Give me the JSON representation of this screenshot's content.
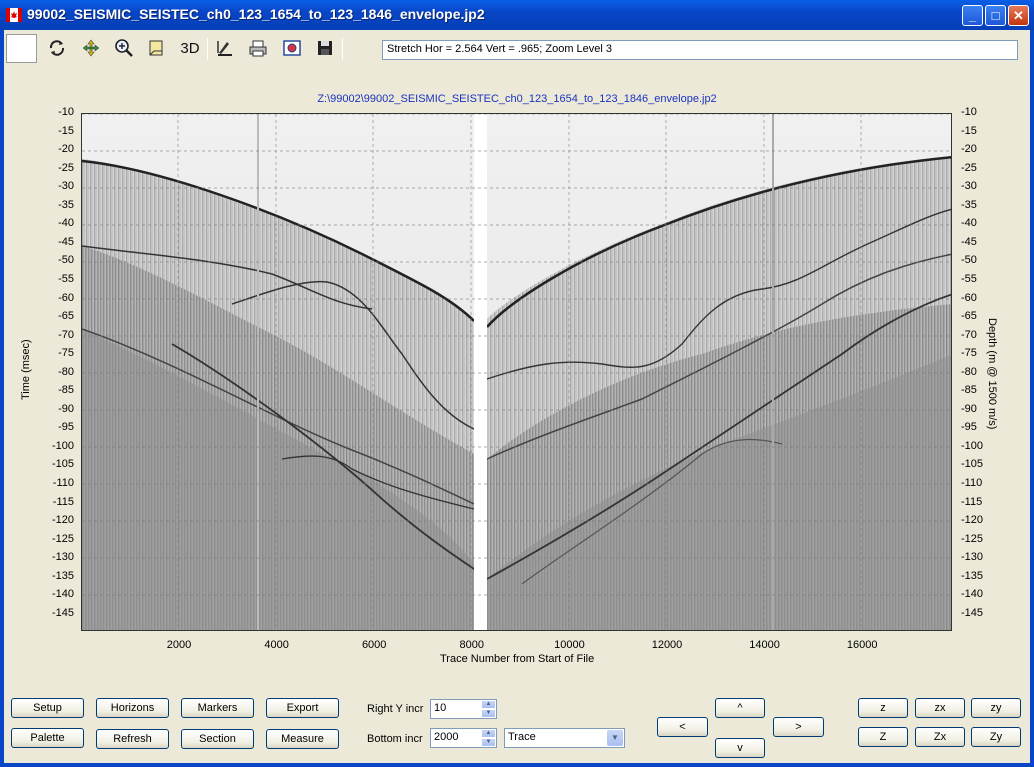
{
  "window": {
    "title": "99002_SEISMIC_SEISTEC_ch0_123_1654_to_123_1846_envelope.jp2"
  },
  "toolbar": {
    "threed_label": "3D",
    "status_text": "Stretch Hor = 2.564 Vert = .965; Zoom Level 3"
  },
  "plot": {
    "file_path": "Z:\\99002\\99002_SEISMIC_SEISTEC_ch0_123_1654_to_123_1846_envelope.jp2",
    "y_left_title": "Time (msec)",
    "y_right_title": "Depth (m @ 1500 m/s)",
    "x_title": "Trace Number from Start of File",
    "y_ticks": [
      "-10",
      "-15",
      "-20",
      "-25",
      "-30",
      "-35",
      "-40",
      "-45",
      "-50",
      "-55",
      "-60",
      "-65",
      "-70",
      "-75",
      "-80",
      "-85",
      "-90",
      "-95",
      "-100",
      "-105",
      "-110",
      "-115",
      "-120",
      "-125",
      "-130",
      "-135",
      "-140",
      "-145"
    ],
    "x_ticks": [
      "2000",
      "4000",
      "6000",
      "8000",
      "10000",
      "12000",
      "14000",
      "16000"
    ]
  },
  "controls": {
    "setup": "Setup",
    "palette": "Palette",
    "horizons": "Horizons",
    "refresh": "Refresh",
    "markers": "Markers",
    "section": "Section",
    "export": "Export",
    "measure": "Measure",
    "right_y_label": "Right Y incr",
    "right_y_value": "10",
    "bottom_label": "Bottom  incr",
    "bottom_value": "2000",
    "axis_mode": "Trace",
    "nav_up": "^",
    "nav_down": "v",
    "nav_left": "<",
    "nav_right": ">",
    "z_small": "z",
    "zx_small": "zx",
    "zy_small": "zy",
    "z_big": "Z",
    "zx_big": "Zx",
    "zy_big": "Zy"
  }
}
